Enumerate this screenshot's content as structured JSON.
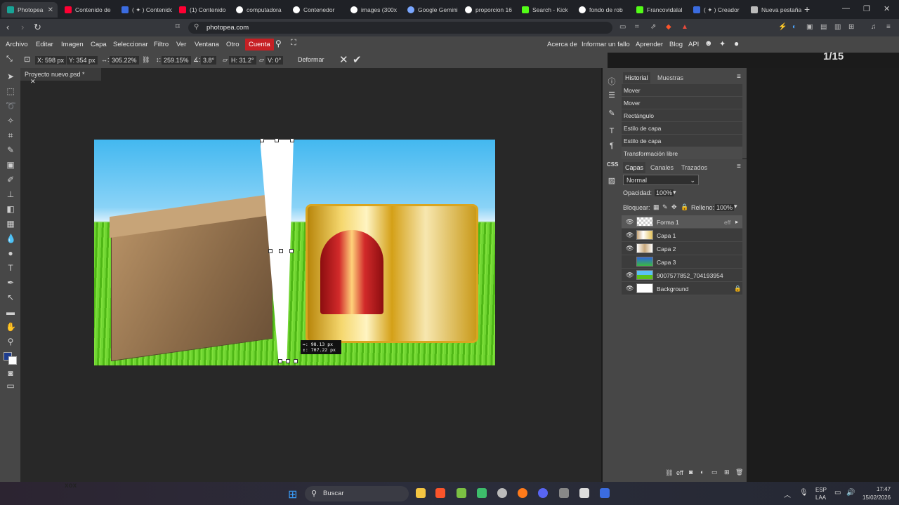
{
  "browser": {
    "tabs": [
      {
        "label": "Photopea",
        "icon": "photopea-icon",
        "color": "#18a497"
      },
      {
        "label": "Contenido de",
        "icon": "youtube-studio-icon",
        "color": "#ff0033"
      },
      {
        "label": "( ✦ ) Contenido",
        "icon": "app-icon",
        "color": "#3b6ce0"
      },
      {
        "label": "(1) Contenido",
        "icon": "youtube-icon",
        "color": "#ff0033"
      },
      {
        "label": "computadora",
        "icon": "google-icon",
        "color": "#ffffff"
      },
      {
        "label": "Contenedor",
        "icon": "google-icon",
        "color": "#ffffff"
      },
      {
        "label": "images (300x",
        "icon": "google-icon",
        "color": "#ffffff"
      },
      {
        "label": "Google Gemini",
        "icon": "gemini-icon",
        "color": "#7aa7ff"
      },
      {
        "label": "proporcion 16",
        "icon": "google-icon",
        "color": "#ffffff"
      },
      {
        "label": "Search - Kick",
        "icon": "kick-icon",
        "color": "#53fc18"
      },
      {
        "label": "fondo de rob",
        "icon": "google-icon",
        "color": "#ffffff"
      },
      {
        "label": "Francovidalal",
        "icon": "kick-icon",
        "color": "#53fc18"
      },
      {
        "label": "( ✦ ) Creador",
        "icon": "app-icon",
        "color": "#3b6ce0"
      },
      {
        "label": "Nueva pestaña",
        "icon": "brave-icon",
        "color": "#bbbbbb"
      }
    ],
    "url": "photopea.com"
  },
  "menu": [
    "Archivo",
    "Editar",
    "Imagen",
    "Capa",
    "Seleccionar",
    "Filtro",
    "Ver",
    "Ventana",
    "Otro"
  ],
  "account": "Cuenta",
  "right_menu": [
    "Acerca de",
    "Informar un fallo",
    "Aprender",
    "Blog",
    "API"
  ],
  "counter": "1/15",
  "options": {
    "x": "X: 598 px",
    "y": "Y: 354 px",
    "w": "305.22%",
    "h": "259.15%",
    "angle": "3.8°",
    "hskew": "H: 31.2°",
    "vskew": "V: 0°",
    "warp": "Deformar"
  },
  "document": {
    "tab": "Proyecto nuevo.psd *"
  },
  "tooltip": {
    "line1": "↔: 98.13 px",
    "line2": "↕: 707.22 px"
  },
  "history": {
    "tabs": [
      "Historial",
      "Muestras"
    ],
    "items": [
      "Mover",
      "Mover",
      "Rectángulo",
      "Estilo de capa",
      "Estilo de capa",
      "Transformación libre"
    ]
  },
  "layers_panel": {
    "tabs": [
      "Capas",
      "Canales",
      "Trazados"
    ],
    "blend": "Normal",
    "opacity_label": "Opacidad:",
    "opacity": "100%",
    "lock_label": "Bloquear:",
    "fill_label": "Relleno:",
    "fill": "100%",
    "layers": [
      {
        "name": "Forma 1",
        "fx": "eff",
        "visible": true
      },
      {
        "name": "Capa 1",
        "visible": true
      },
      {
        "name": "Capa 2",
        "visible": true
      },
      {
        "name": "Capa 3",
        "visible": false
      },
      {
        "name": "9007577852_704193954",
        "visible": true
      },
      {
        "name": "Background",
        "visible": true
      }
    ]
  },
  "taskbar": {
    "search": "Buscar",
    "lang1": "ESP",
    "lang2": "LAA",
    "time": "17:47",
    "date": "15/02/2026",
    "bottom_left": "xox"
  }
}
